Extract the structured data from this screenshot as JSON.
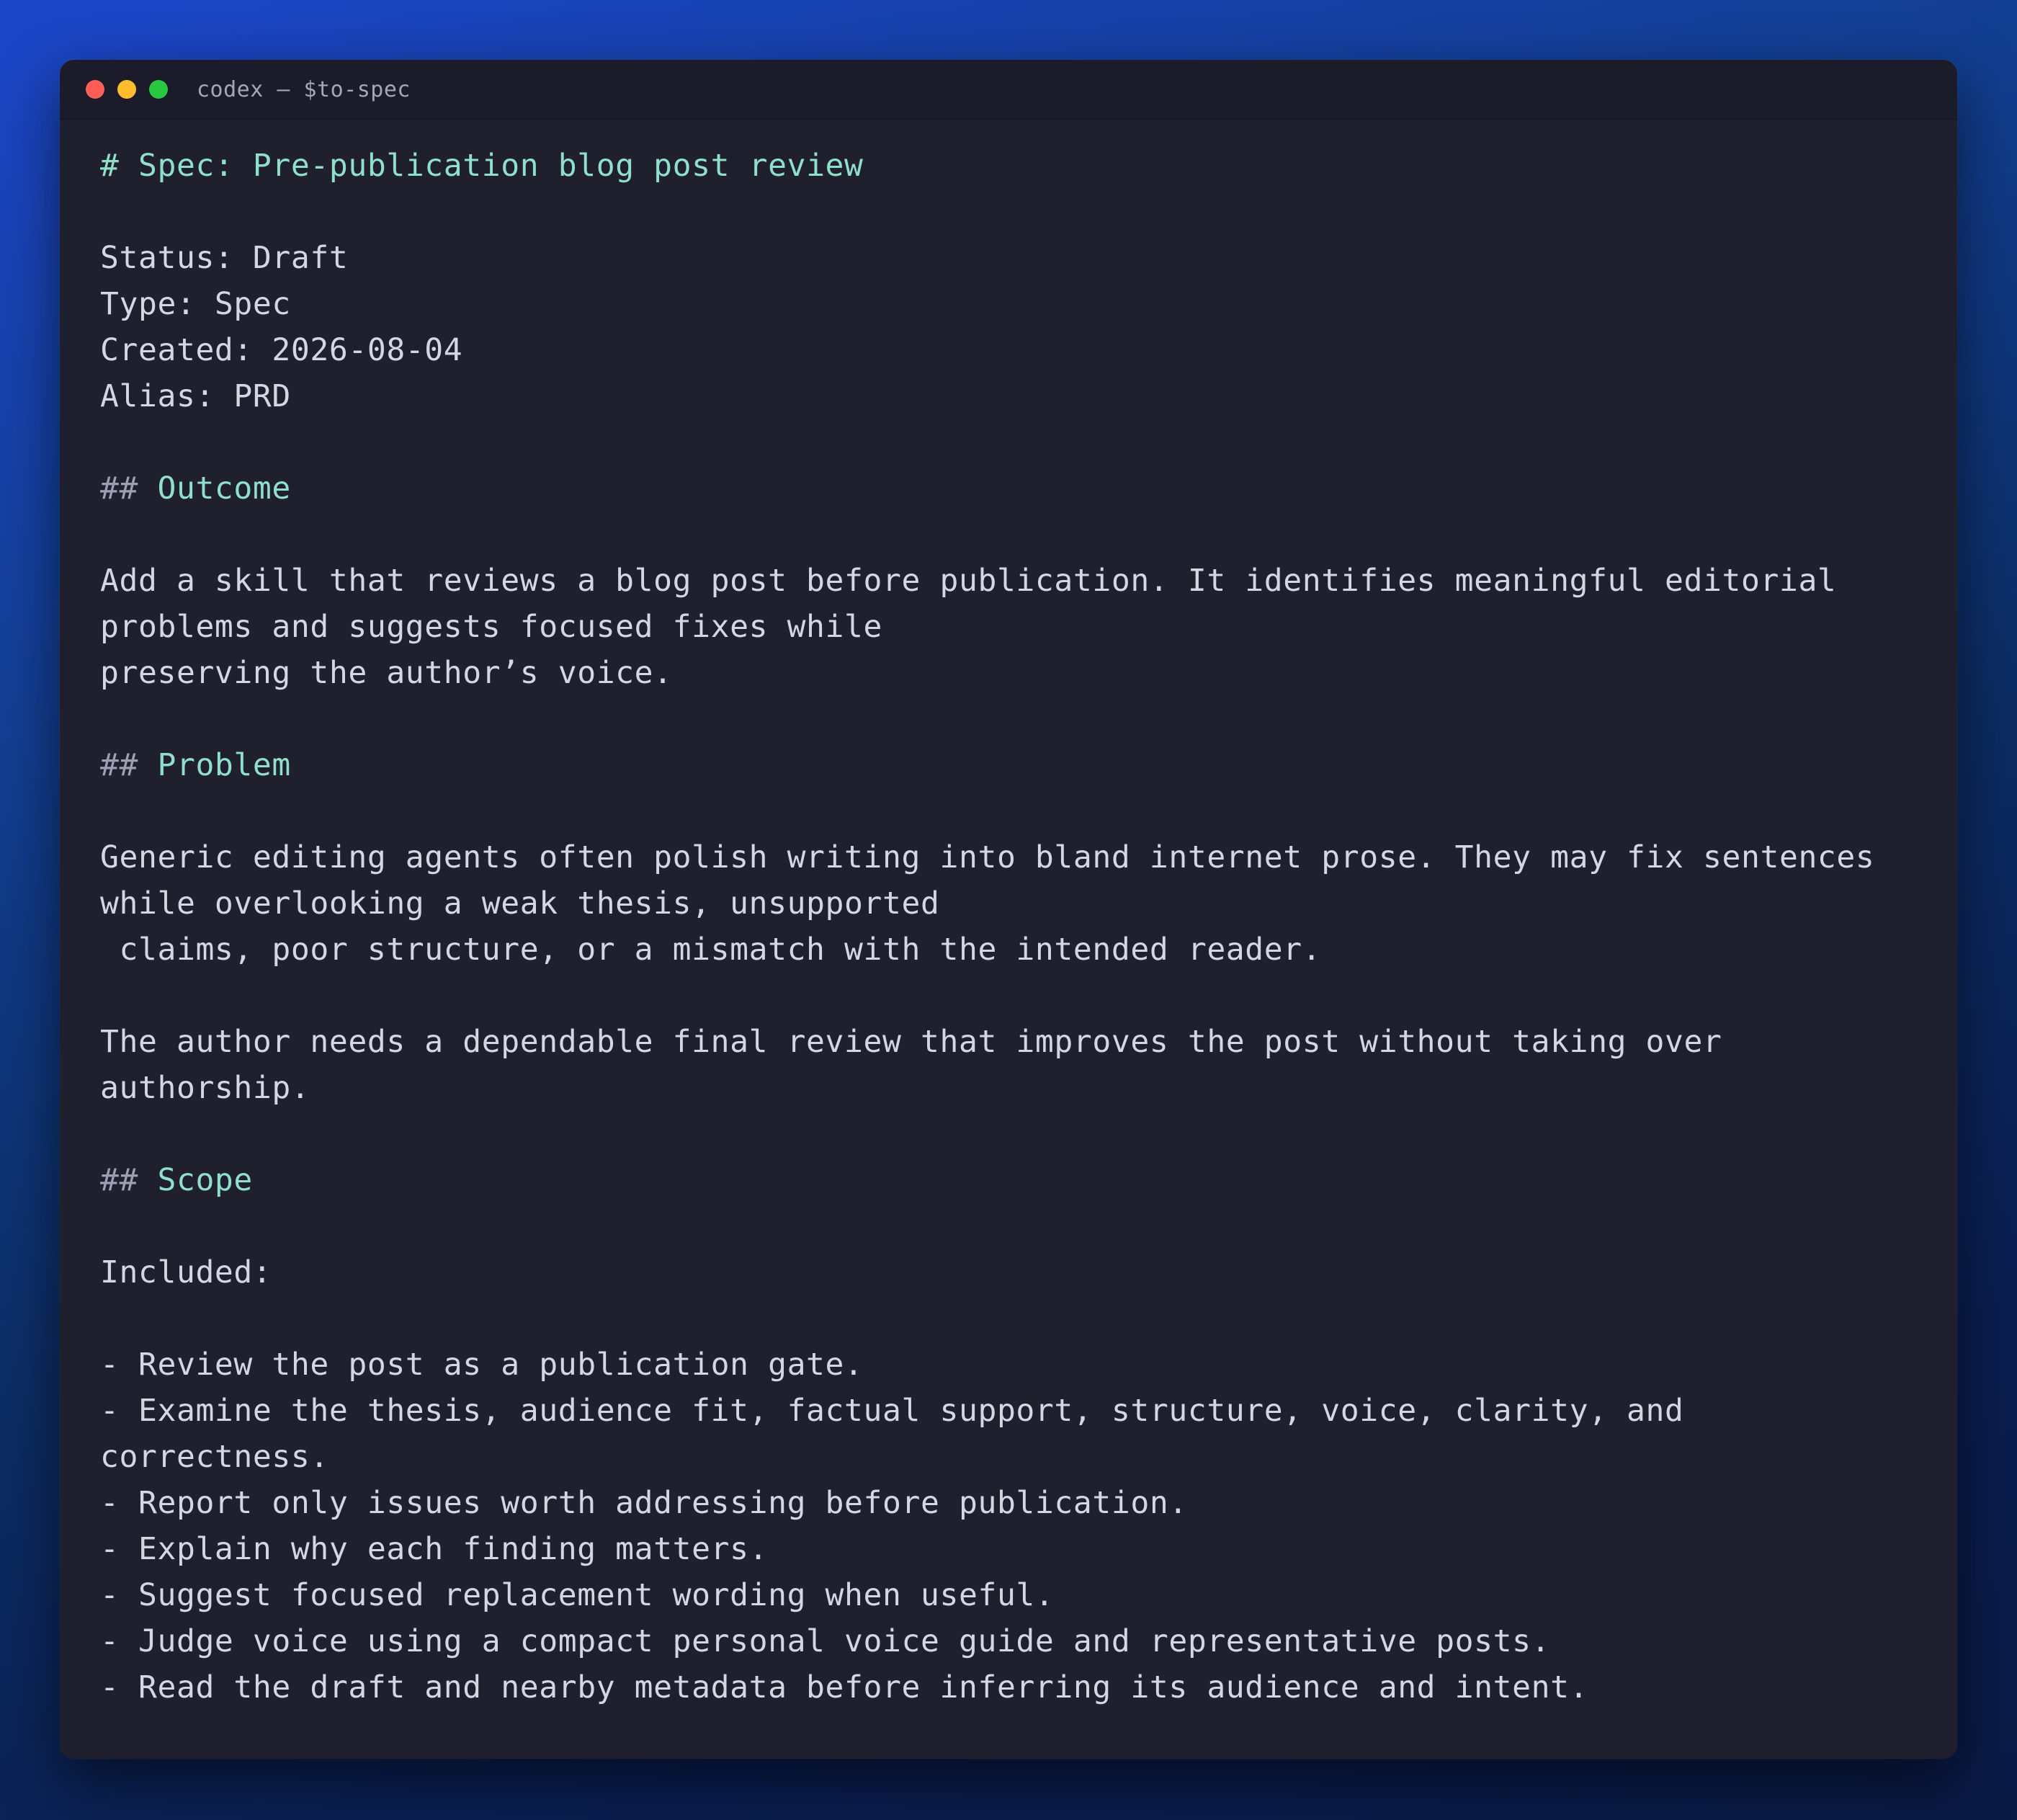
{
  "window": {
    "title": "codex — $to-spec",
    "lights": {
      "close": "#ff5f57",
      "minimize": "#febc2e",
      "maximize": "#28c840"
    }
  },
  "colors": {
    "background": "#1f1f2e",
    "titlebar": "#1b1b29",
    "text": "#d4d6e2",
    "heading": "#8fdfcb"
  },
  "doc": {
    "h1_hash": "# ",
    "h1_text": "Spec: Pre-publication blog post review",
    "status": "Status: Draft",
    "type": "Type: Spec",
    "created": "Created: 2026-08-04",
    "alias": "Alias: PRD",
    "outcome_hash": "## ",
    "outcome_text": "Outcome",
    "outcome_p": [
      "Add a skill that reviews a blog post before publication. It identifies meaningful editorial",
      "problems and suggests focused fixes while",
      "preserving the author’s voice."
    ],
    "problem_hash": "## ",
    "problem_text": "Problem",
    "problem_p1": [
      "Generic editing agents often polish writing into bland internet prose. They may fix sentences",
      "while overlooking a weak thesis, unsupported",
      " claims, poor structure, or a mismatch with the intended reader."
    ],
    "problem_p2": [
      "The author needs a dependable final review that improves the post without taking over",
      "authorship."
    ],
    "scope_hash": "## ",
    "scope_text": "Scope",
    "included": "Included:",
    "scope_items": [
      "- Review the post as a publication gate.",
      "- Examine the thesis, audience fit, factual support, structure, voice, clarity, and",
      "correctness.",
      "- Report only issues worth addressing before publication.",
      "- Explain why each finding matters.",
      "- Suggest focused replacement wording when useful.",
      "- Judge voice using a compact personal voice guide and representative posts.",
      "- Read the draft and nearby metadata before inferring its audience and intent."
    ]
  }
}
